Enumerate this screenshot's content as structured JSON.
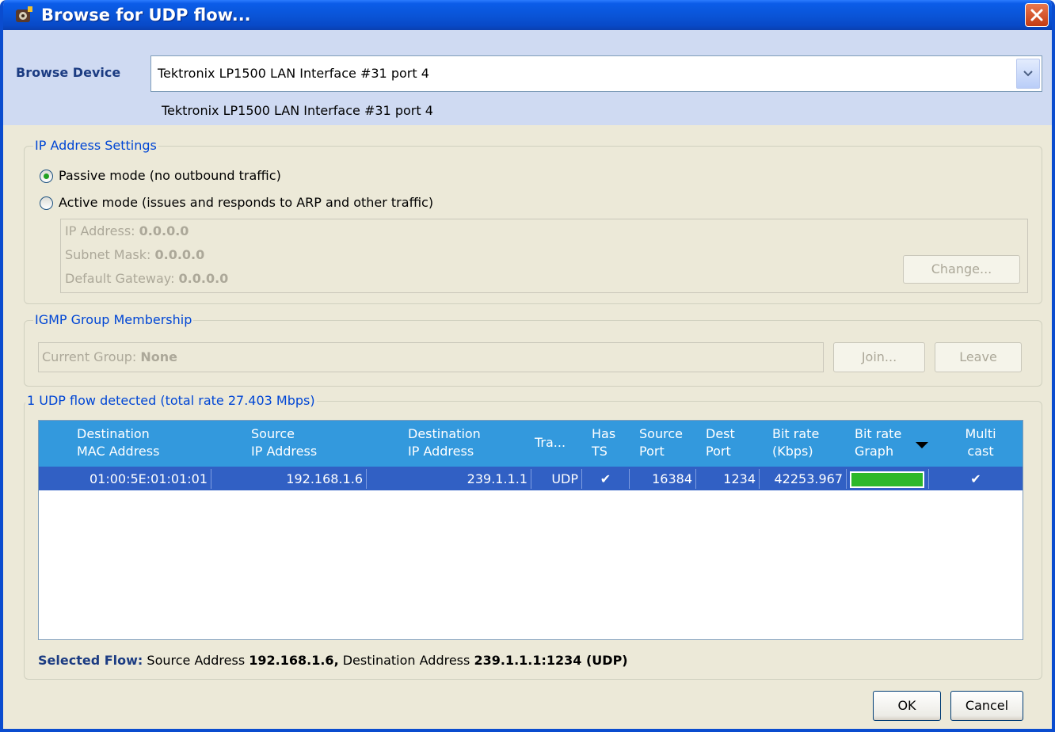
{
  "window": {
    "title": "Browse for UDP flow..."
  },
  "device": {
    "label": "Browse Device",
    "selected": "Tektronix LP1500 LAN Interface #31 port 4",
    "description": "Tektronix LP1500 LAN Interface #31 port 4"
  },
  "ip_settings": {
    "group_title": "IP Address Settings",
    "passive_label": "Passive mode (no outbound traffic)",
    "passive_selected": true,
    "active_label": "Active mode (issues and responds to ARP and other traffic)",
    "ip_address_label": "IP Address:",
    "ip_address_value": "0.0.0.0",
    "subnet_mask_label": "Subnet Mask:",
    "subnet_mask_value": "0.0.0.0",
    "gateway_label": "Default Gateway:",
    "gateway_value": "0.0.0.0",
    "change_button": "Change..."
  },
  "igmp": {
    "group_title": "IGMP Group Membership",
    "current_group_label": "Current Group:",
    "current_group_value": "None",
    "join_button": "Join...",
    "leave_button": "Leave"
  },
  "flows": {
    "group_title": "1 UDP flow detected (total rate 27.403 Mbps)",
    "columns": [
      {
        "line1": "Destination",
        "line2": "MAC Address"
      },
      {
        "line1": "Source",
        "line2": "IP Address"
      },
      {
        "line1": "Destination",
        "line2": "IP Address"
      },
      {
        "line1": "",
        "line2": "Tra..."
      },
      {
        "line1": "Has",
        "line2": "TS"
      },
      {
        "line1": "Source",
        "line2": "Port"
      },
      {
        "line1": "Dest",
        "line2": "Port"
      },
      {
        "line1": "Bit rate",
        "line2": "(Kbps)"
      },
      {
        "line1": "Bit rate",
        "line2": "Graph"
      },
      {
        "line1": "Multi",
        "line2": "cast"
      }
    ],
    "rows": [
      {
        "dest_mac": "01:00:5E:01:01:01",
        "source_ip": "192.168.1.6",
        "dest_ip": "239.1.1.1",
        "transport": "UDP",
        "has_ts": "✔",
        "source_port": "16384",
        "dest_port": "1234",
        "bitrate": "42253.967",
        "bitrate_graph_fraction": 1.0,
        "multicast": "✔"
      }
    ]
  },
  "selected_flow": {
    "label": "Selected Flow:",
    "source_prefix": "Source Address",
    "source_value": "192.168.1.6,",
    "dest_prefix": "Destination Address",
    "dest_value": "239.1.1.1:1234 (UDP)"
  },
  "buttons": {
    "ok": "OK",
    "cancel": "Cancel"
  },
  "colors": {
    "titlebar": "#0a55d8",
    "table_header": "#3399dd",
    "selected_row": "#3160c4",
    "bar_fill": "#2db82a",
    "group_title": "#0046d5"
  }
}
